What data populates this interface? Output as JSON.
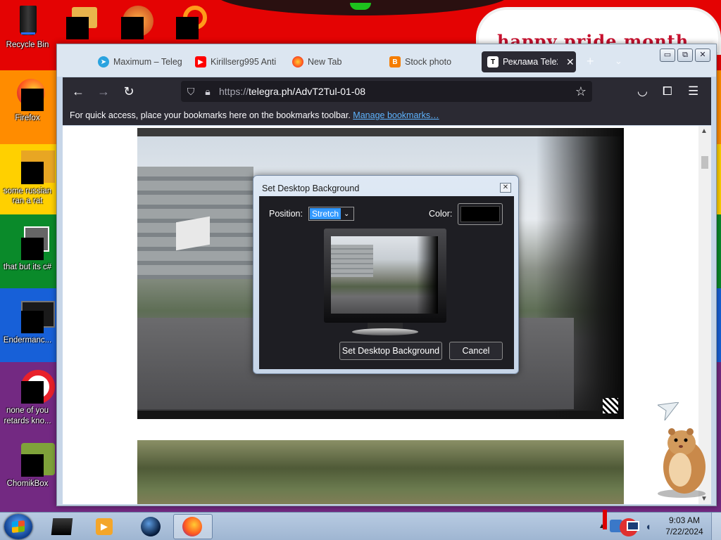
{
  "desktop": {
    "banner_text": "happy pride month",
    "icons": [
      {
        "label": "Recycle Bin"
      },
      {
        "label": "Firefox"
      },
      {
        "label": "some russian ran a rat"
      },
      {
        "label": "that but its c#"
      },
      {
        "label": "Endermanc..."
      },
      {
        "label": "none of you retards kno..."
      },
      {
        "label": "ChomikBox"
      }
    ]
  },
  "browser": {
    "tabs": [
      {
        "label": "Maximum – Teleg",
        "icon": "telegram-icon"
      },
      {
        "label": "Kirillserg995 Anti",
        "icon": "youtube-icon"
      },
      {
        "label": "New Tab",
        "icon": "firefox-icon"
      },
      {
        "label": "Stock photo",
        "icon": "blogger-icon"
      },
      {
        "label": "Реклама Tele2",
        "icon": "telegraph-icon",
        "active": true
      }
    ],
    "url_prefix": "https://",
    "url_main": "telegra.ph/AdvT2Tul-01-08",
    "bookmarks_text": "For quick access, place your bookmarks here on the bookmarks toolbar.",
    "bookmarks_link": "Manage bookmarks…"
  },
  "dialog": {
    "title": "Set Desktop Background",
    "position_label": "Position:",
    "position_value": "Stretch",
    "color_label": "Color:",
    "color_value": "#000000",
    "set_button": "Set Desktop Background",
    "cancel_button": "Cancel"
  },
  "taskbar": {
    "time": "9:03 AM",
    "date": "7/22/2024"
  },
  "colors": {
    "firefox_dark": "#2b2a33",
    "link": "#5eb4ff",
    "selection": "#3399ff"
  }
}
